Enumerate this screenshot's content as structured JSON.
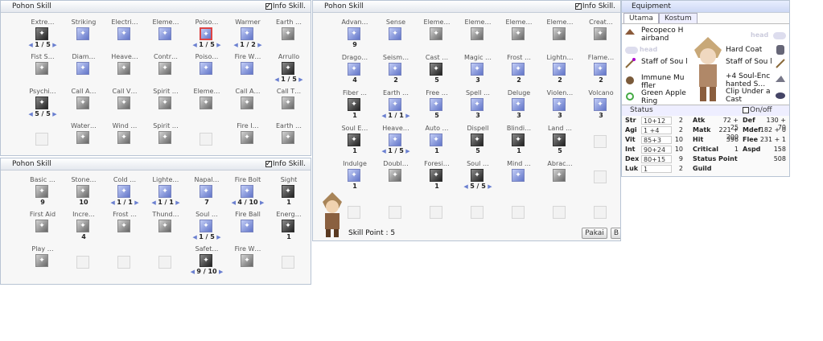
{
  "window1": {
    "title": "Pohon Skill",
    "info_label": "Info Skill.",
    "rows": [
      [
        {
          "n": "Extre…",
          "c": "dark",
          "l": "1 / 5"
        },
        {
          "n": "Striking",
          "c": "blue"
        },
        {
          "n": "Electri…",
          "c": "blue"
        },
        {
          "n": "Eleme…",
          "c": "blue"
        },
        {
          "n": "Poiso…",
          "c": "red",
          "l": "1 / 5"
        },
        {
          "n": "Warmer",
          "c": "blue",
          "l": "1 / 2"
        },
        {
          "n": "Earth …",
          "c": "grey"
        }
      ],
      [
        {
          "n": "Fist S…",
          "c": "grey"
        },
        {
          "n": "Diam…",
          "c": "blue"
        },
        {
          "n": "Heave…",
          "c": "grey"
        },
        {
          "n": "Contr…",
          "c": "grey"
        },
        {
          "n": "Poiso…",
          "c": "blue"
        },
        {
          "n": "Fire W…",
          "c": "blue"
        },
        {
          "n": "Arrullo",
          "c": "dark",
          "l": "1 / 5"
        }
      ],
      [
        {
          "n": "Psychi…",
          "c": "dark",
          "l": "5 / 5"
        },
        {
          "n": "Call A…",
          "c": "grey"
        },
        {
          "n": "Call V…",
          "c": "grey"
        },
        {
          "n": "Spirit …",
          "c": "grey"
        },
        {
          "n": "Eleme…",
          "c": "grey"
        },
        {
          "n": "Call A…",
          "c": "grey"
        },
        {
          "n": "Call T…",
          "c": "grey"
        }
      ],
      [
        {
          "n": "",
          "c": "empty"
        },
        {
          "n": "Water…",
          "c": "grey"
        },
        {
          "n": "Wind …",
          "c": "grey"
        },
        {
          "n": "Spirit …",
          "c": "grey"
        },
        {
          "n": "",
          "c": "empty"
        },
        {
          "n": "Fire I…",
          "c": "grey"
        },
        {
          "n": "Earth …",
          "c": "grey"
        }
      ]
    ]
  },
  "window2": {
    "title": "Pohon Skill",
    "info_label": "Info Skill.",
    "rows": [
      [
        {
          "n": "Basic …",
          "c": "grey",
          "l": "9"
        },
        {
          "n": "Stone…",
          "c": "grey",
          "l": "10"
        },
        {
          "n": "Cold …",
          "c": "blue",
          "l": "1 / 1"
        },
        {
          "n": "Lighte…",
          "c": "blue",
          "l": "1 / 1"
        },
        {
          "n": "Napal…",
          "c": "blue",
          "l": "7"
        },
        {
          "n": "Fire Bolt",
          "c": "blue",
          "l": "4 / 10"
        },
        {
          "n": "Sight",
          "c": "dark",
          "l": "1"
        }
      ],
      [
        {
          "n": "First Aid",
          "c": "grey"
        },
        {
          "n": "Incre…",
          "c": "grey",
          "l": "4"
        },
        {
          "n": "Frost …",
          "c": "grey"
        },
        {
          "n": "Thund…",
          "c": "grey"
        },
        {
          "n": "Soul …",
          "c": "blue",
          "l": "1 / 5"
        },
        {
          "n": "Fire Ball",
          "c": "blue"
        },
        {
          "n": "Energ…",
          "c": "dark",
          "l": "1"
        }
      ],
      [
        {
          "n": "Play …",
          "c": "grey"
        },
        {
          "n": "",
          "c": "empty"
        },
        {
          "n": "",
          "c": "empty"
        },
        {
          "n": "",
          "c": "empty"
        },
        {
          "n": "Safet…",
          "c": "dark",
          "l": "9 / 10"
        },
        {
          "n": "Fire W…",
          "c": "grey"
        },
        {
          "n": "",
          "c": "empty"
        }
      ]
    ]
  },
  "window3": {
    "title": "Pohon Skill",
    "info_label": "Info Skill.",
    "rows": [
      [
        {
          "n": "Advan…",
          "c": "blue",
          "l": "9"
        },
        {
          "n": "Sense",
          "c": "blue"
        },
        {
          "n": "Eleme…",
          "c": "grey"
        },
        {
          "n": "Eleme…",
          "c": "grey"
        },
        {
          "n": "Eleme…",
          "c": "grey"
        },
        {
          "n": "Eleme…",
          "c": "grey"
        },
        {
          "n": "Creat…",
          "c": "grey"
        }
      ],
      [
        {
          "n": "Drago…",
          "c": "blue",
          "l": "4"
        },
        {
          "n": "Seism…",
          "c": "blue",
          "l": "2"
        },
        {
          "n": "Cast …",
          "c": "dark",
          "l": "5"
        },
        {
          "n": "Magic …",
          "c": "blue",
          "l": "3"
        },
        {
          "n": "Frost …",
          "c": "blue",
          "l": "2"
        },
        {
          "n": "Lightn…",
          "c": "blue",
          "l": "2"
        },
        {
          "n": "Flame…",
          "c": "blue",
          "l": "2"
        }
      ],
      [
        {
          "n": "Fiber …",
          "c": "dark",
          "l": "1"
        },
        {
          "n": "Earth …",
          "c": "blue",
          "l": "1 / 1"
        },
        {
          "n": "Free …",
          "c": "blue",
          "l": "5"
        },
        {
          "n": "Spell …",
          "c": "blue",
          "l": "3"
        },
        {
          "n": "Deluge",
          "c": "blue",
          "l": "3"
        },
        {
          "n": "Violen…",
          "c": "blue",
          "l": "3"
        },
        {
          "n": "Volcano",
          "c": "blue",
          "l": "3"
        }
      ],
      [
        {
          "n": "Soul E…",
          "c": "dark",
          "l": "1"
        },
        {
          "n": "Heave…",
          "c": "blue",
          "l": "1 / 5"
        },
        {
          "n": "Auto …",
          "c": "blue",
          "l": "1"
        },
        {
          "n": "Dispell",
          "c": "dark",
          "l": "5"
        },
        {
          "n": "Blindi…",
          "c": "dark",
          "l": "1"
        },
        {
          "n": "Land …",
          "c": "dark",
          "l": "5"
        },
        {
          "n": "",
          "c": "empty"
        }
      ],
      [
        {
          "n": "Indulge",
          "c": "blue",
          "l": "1"
        },
        {
          "n": "Doubl…",
          "c": "grey"
        },
        {
          "n": "Foresi…",
          "c": "dark",
          "l": "1"
        },
        {
          "n": "Soul …",
          "c": "dark",
          "l": "5 / 5"
        },
        {
          "n": "Mind …",
          "c": "blue"
        },
        {
          "n": "Abrac…",
          "c": "grey"
        },
        {
          "n": "",
          "c": "empty"
        }
      ],
      [
        {
          "n": "",
          "c": "empty"
        },
        {
          "n": "",
          "c": "empty"
        },
        {
          "n": "",
          "c": "empty"
        },
        {
          "n": "",
          "c": "empty"
        },
        {
          "n": "",
          "c": "empty"
        },
        {
          "n": "",
          "c": "empty"
        },
        {
          "n": "",
          "c": "empty"
        }
      ]
    ],
    "skill_point": "Skill Point : 5",
    "btn_apply": "Pakai",
    "btn_b": "B"
  },
  "equipment": {
    "title": "Equipment",
    "tabs": [
      "Utama",
      "Kostum"
    ],
    "head_labels": [
      "head",
      "head"
    ],
    "left_items": [
      "Pecopeco H airband",
      "Staff of Sou l",
      "Immune Mu ffler",
      "Green Apple Ring"
    ],
    "right_items": [
      "Hard Coat",
      "Staff of Sou l",
      "+4 Soul-Enc hanted S…",
      "Clip Under a Cast"
    ],
    "status_label": "Status",
    "onoff_label": "On/off",
    "stats": [
      {
        "k": "Str",
        "v": "10+12",
        "b": "2",
        "k2": "Atk",
        "v2": "72 + 25",
        "k3": "Def",
        "v3": "130 + 70"
      },
      {
        "k": "Agi",
        "v": "1 +4",
        "b": "2",
        "k2": "Matk",
        "v2": "221 + 200",
        "k3": "Mdef",
        "v3": "182 + 0"
      },
      {
        "k": "Vit",
        "v": "85+3",
        "b": "10",
        "k2": "Hit",
        "v2": "396",
        "k3": "Flee",
        "v3": "231 + 1"
      },
      {
        "k": "Int",
        "v": "90+24",
        "b": "10",
        "k2": "Critical",
        "v2": "1",
        "k3": "Aspd",
        "v3": "158"
      },
      {
        "k": "Dex",
        "v": "80+15",
        "b": "9",
        "k2": "Status Point",
        "v2": "",
        "k3": "",
        "v3": "508"
      },
      {
        "k": "Luk",
        "v": "1",
        "b": "2",
        "k2": "Guild",
        "v2": "",
        "k3": "",
        "v3": ""
      }
    ]
  }
}
